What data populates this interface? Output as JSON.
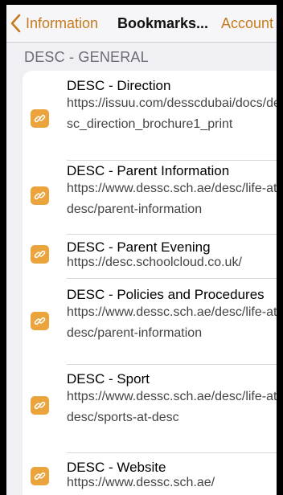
{
  "nav": {
    "back_label": "Information",
    "title": "Bookmarks...",
    "right_label": "Account"
  },
  "section": {
    "header": "DESC - GENERAL"
  },
  "items": [
    {
      "title": "DESC - Direction",
      "url": "https://issuu.com/desscdubai/docs/desc_direction_brochure1_print",
      "icon": "link-icon"
    },
    {
      "title": "DESC - Parent Information",
      "url": "https://www.dessc.sch.ae/desc/life-at-desc/parent-information",
      "icon": "link-icon"
    },
    {
      "title": "DESC - Parent Evening",
      "url": "https://desc.schoolcloud.co.uk/",
      "icon": "link-icon"
    },
    {
      "title": "DESC - Policies and Procedures",
      "url": "https://www.dessc.sch.ae/desc/life-at-desc/parent-information",
      "icon": "link-icon"
    },
    {
      "title": "DESC - Sport",
      "url": "https://www.dessc.sch.ae/desc/life-at-desc/sports-at-desc",
      "icon": "link-icon"
    },
    {
      "title": "DESC - Website",
      "url": "https://www.dessc.sch.ae/",
      "icon": "link-icon"
    }
  ],
  "colors": {
    "accent": "#c77a1e",
    "icon_bg": "#eaa43b"
  }
}
